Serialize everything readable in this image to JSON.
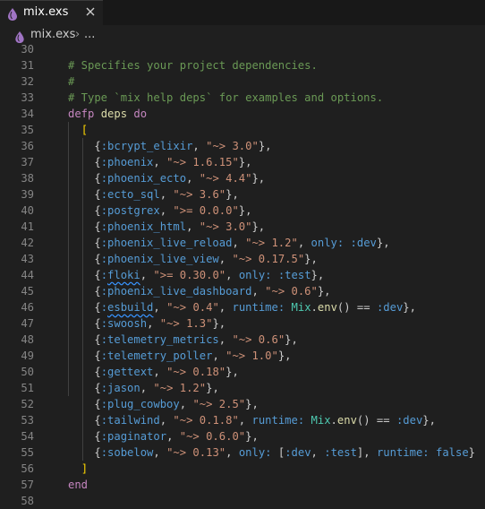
{
  "tab": {
    "filename": "mix.exs",
    "icon": "elixir-drop-icon",
    "close_icon": "close-icon"
  },
  "breadcrumb": {
    "file": "mix.exs",
    "separator": "›",
    "more": "..."
  },
  "colors": {
    "comment": "#6a9955",
    "keyword": "#c586c0",
    "function": "#dcdcaa",
    "atom": "#569cd6",
    "string": "#ce9178",
    "module": "#4ec9b0",
    "bracket": "#ffd700",
    "line_number": "#858585",
    "background": "#1f1f1f"
  },
  "editor": {
    "lines": [
      {
        "n": "30",
        "t": []
      },
      {
        "n": "31",
        "t": [
          [
            "c",
            "# Specifies your project dependencies."
          ]
        ]
      },
      {
        "n": "32",
        "t": [
          [
            "c",
            "#"
          ]
        ]
      },
      {
        "n": "33",
        "t": [
          [
            "c",
            "# Type `mix help deps` for examples and options."
          ]
        ]
      },
      {
        "n": "34",
        "t": [
          [
            "k",
            "defp"
          ],
          [
            "p",
            " "
          ],
          [
            "f",
            "deps"
          ],
          [
            "p",
            " "
          ],
          [
            "k",
            "do"
          ]
        ]
      },
      {
        "n": "35",
        "t": [
          [
            "p",
            "  "
          ],
          [
            "b",
            "["
          ]
        ]
      },
      {
        "n": "36",
        "t": [
          [
            "p",
            "    {"
          ],
          [
            "a",
            ":bcrypt_elixir"
          ],
          [
            "p",
            ", "
          ],
          [
            "s",
            "\"~> 3.0\""
          ],
          [
            "p",
            "},"
          ]
        ]
      },
      {
        "n": "37",
        "t": [
          [
            "p",
            "    {"
          ],
          [
            "a",
            ":phoenix"
          ],
          [
            "p",
            ", "
          ],
          [
            "s",
            "\"~> 1.6.15\""
          ],
          [
            "p",
            "},"
          ]
        ]
      },
      {
        "n": "38",
        "t": [
          [
            "p",
            "    {"
          ],
          [
            "a",
            ":phoenix_ecto"
          ],
          [
            "p",
            ", "
          ],
          [
            "s",
            "\"~> 4.4\""
          ],
          [
            "p",
            "},"
          ]
        ]
      },
      {
        "n": "39",
        "t": [
          [
            "p",
            "    {"
          ],
          [
            "a",
            ":ecto_sql"
          ],
          [
            "p",
            ", "
          ],
          [
            "s",
            "\"~> 3.6\""
          ],
          [
            "p",
            "},"
          ]
        ]
      },
      {
        "n": "40",
        "t": [
          [
            "p",
            "    {"
          ],
          [
            "a",
            ":postgrex"
          ],
          [
            "p",
            ", "
          ],
          [
            "s",
            "\">= 0.0.0\""
          ],
          [
            "p",
            "},"
          ]
        ]
      },
      {
        "n": "41",
        "t": [
          [
            "p",
            "    {"
          ],
          [
            "a",
            ":phoenix_html"
          ],
          [
            "p",
            ", "
          ],
          [
            "s",
            "\"~> 3.0\""
          ],
          [
            "p",
            "},"
          ]
        ]
      },
      {
        "n": "42",
        "t": [
          [
            "p",
            "    {"
          ],
          [
            "a",
            ":phoenix_live_reload"
          ],
          [
            "p",
            ", "
          ],
          [
            "s",
            "\"~> 1.2\""
          ],
          [
            "p",
            ", "
          ],
          [
            "a",
            "only:"
          ],
          [
            "p",
            " "
          ],
          [
            "a",
            ":dev"
          ],
          [
            "p",
            "},"
          ]
        ]
      },
      {
        "n": "43",
        "t": [
          [
            "p",
            "    {"
          ],
          [
            "a",
            ":phoenix_live_view"
          ],
          [
            "p",
            ", "
          ],
          [
            "s",
            "\"~> 0.17.5\""
          ],
          [
            "p",
            "},"
          ]
        ]
      },
      {
        "n": "44",
        "t": [
          [
            "p",
            "    {"
          ],
          [
            "a",
            ":"
          ],
          [
            "a sq",
            "floki"
          ],
          [
            "p",
            ", "
          ],
          [
            "s",
            "\">= 0.30.0\""
          ],
          [
            "p",
            ", "
          ],
          [
            "a",
            "only:"
          ],
          [
            "p",
            " "
          ],
          [
            "a",
            ":test"
          ],
          [
            "p",
            "},"
          ]
        ]
      },
      {
        "n": "45",
        "t": [
          [
            "p",
            "    {"
          ],
          [
            "a",
            ":phoenix_live_dashboard"
          ],
          [
            "p",
            ", "
          ],
          [
            "s",
            "\"~> 0.6\""
          ],
          [
            "p",
            "},"
          ]
        ]
      },
      {
        "n": "46",
        "t": [
          [
            "p",
            "    {"
          ],
          [
            "a",
            ":"
          ],
          [
            "a sq",
            "esbuild"
          ],
          [
            "p",
            ", "
          ],
          [
            "s",
            "\"~> 0.4\""
          ],
          [
            "p",
            ", "
          ],
          [
            "a",
            "runtime:"
          ],
          [
            "p",
            " "
          ],
          [
            "m",
            "Mix"
          ],
          [
            "p",
            "."
          ],
          [
            "f",
            "env"
          ],
          [
            "p",
            "() == "
          ],
          [
            "a",
            ":dev"
          ],
          [
            "p",
            "},"
          ]
        ]
      },
      {
        "n": "47",
        "t": [
          [
            "p",
            "    {"
          ],
          [
            "a",
            ":swoosh"
          ],
          [
            "p",
            ", "
          ],
          [
            "s",
            "\"~> 1.3\""
          ],
          [
            "p",
            "},"
          ]
        ]
      },
      {
        "n": "48",
        "t": [
          [
            "p",
            "    {"
          ],
          [
            "a",
            ":telemetry_metrics"
          ],
          [
            "p",
            ", "
          ],
          [
            "s",
            "\"~> 0.6\""
          ],
          [
            "p",
            "},"
          ]
        ]
      },
      {
        "n": "49",
        "t": [
          [
            "p",
            "    {"
          ],
          [
            "a",
            ":telemetry_poller"
          ],
          [
            "p",
            ", "
          ],
          [
            "s",
            "\"~> 1.0\""
          ],
          [
            "p",
            "},"
          ]
        ]
      },
      {
        "n": "50",
        "t": [
          [
            "p",
            "    {"
          ],
          [
            "a",
            ":gettext"
          ],
          [
            "p",
            ", "
          ],
          [
            "s",
            "\"~> 0.18\""
          ],
          [
            "p",
            "},"
          ]
        ]
      },
      {
        "n": "51",
        "t": [
          [
            "p",
            "    {"
          ],
          [
            "a",
            ":jason"
          ],
          [
            "p",
            ", "
          ],
          [
            "s",
            "\"~> 1.2\""
          ],
          [
            "p",
            "},"
          ]
        ]
      },
      {
        "n": "52",
        "t": [
          [
            "p",
            "    {"
          ],
          [
            "a",
            ":plug_cowboy"
          ],
          [
            "p",
            ", "
          ],
          [
            "s",
            "\"~> 2.5\""
          ],
          [
            "p",
            "},"
          ]
        ]
      },
      {
        "n": "53",
        "t": [
          [
            "p",
            "    {"
          ],
          [
            "a",
            ":tailwind"
          ],
          [
            "p",
            ", "
          ],
          [
            "s",
            "\"~> 0.1.8\""
          ],
          [
            "p",
            ", "
          ],
          [
            "a",
            "runtime:"
          ],
          [
            "p",
            " "
          ],
          [
            "m",
            "Mix"
          ],
          [
            "p",
            "."
          ],
          [
            "f",
            "env"
          ],
          [
            "p",
            "() == "
          ],
          [
            "a",
            ":dev"
          ],
          [
            "p",
            "},"
          ]
        ]
      },
      {
        "n": "54",
        "t": [
          [
            "p",
            "    {"
          ],
          [
            "a",
            ":paginator"
          ],
          [
            "p",
            ", "
          ],
          [
            "s",
            "\"~> 0.6.0\""
          ],
          [
            "p",
            "},"
          ]
        ]
      },
      {
        "n": "55",
        "t": [
          [
            "p",
            "    {"
          ],
          [
            "a",
            ":sobelow"
          ],
          [
            "p",
            ", "
          ],
          [
            "s",
            "\"~> 0.13\""
          ],
          [
            "p",
            ", "
          ],
          [
            "a",
            "only:"
          ],
          [
            "p",
            " ["
          ],
          [
            "a",
            ":dev"
          ],
          [
            "p",
            ", "
          ],
          [
            "a",
            ":test"
          ],
          [
            "p",
            "], "
          ],
          [
            "a",
            "runtime:"
          ],
          [
            "p",
            " "
          ],
          [
            "a",
            "false"
          ],
          [
            "p",
            "}"
          ]
        ]
      },
      {
        "n": "56",
        "t": [
          [
            "p",
            "  "
          ],
          [
            "b",
            "]"
          ]
        ]
      },
      {
        "n": "57",
        "t": [
          [
            "k",
            "end"
          ]
        ]
      },
      {
        "n": "58",
        "t": []
      }
    ]
  }
}
